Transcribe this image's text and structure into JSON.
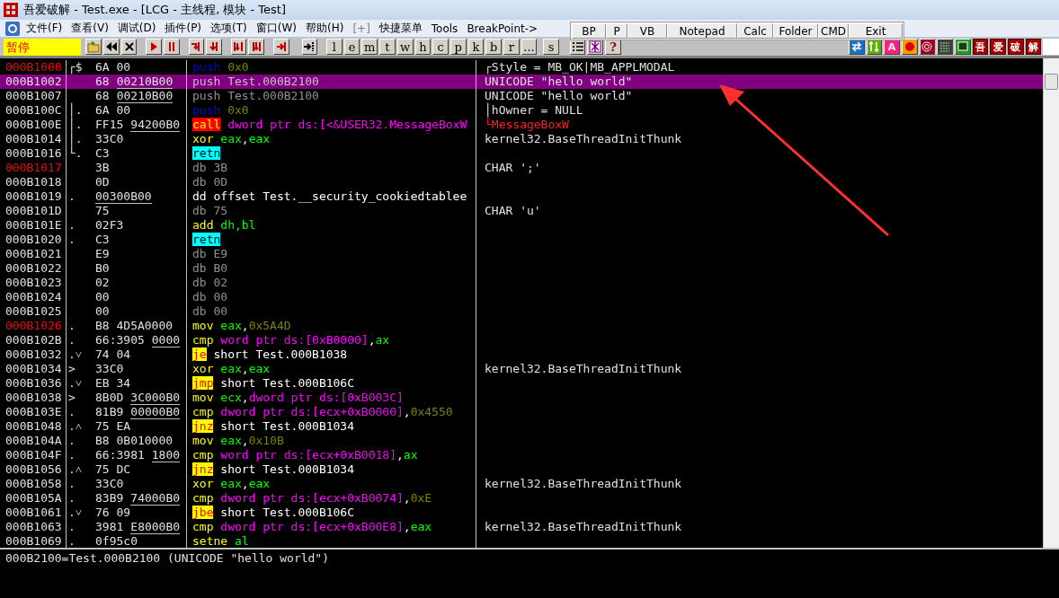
{
  "window": {
    "title": "吾爱破解 - Test.exe - [LCG - 主线程, 模块 - Test]"
  },
  "menu": [
    {
      "label": "文件(F)",
      "disabled": false
    },
    {
      "label": "查看(V)",
      "disabled": false
    },
    {
      "label": "调试(D)",
      "disabled": false
    },
    {
      "label": "插件(P)",
      "disabled": false
    },
    {
      "label": "选项(T)",
      "disabled": false
    },
    {
      "label": "窗口(W)",
      "disabled": false
    },
    {
      "label": "帮助(H)",
      "disabled": false
    },
    {
      "label": "[+]",
      "disabled": true
    },
    {
      "label": "快捷菜单",
      "disabled": false
    },
    {
      "label": "Tools",
      "disabled": false
    },
    {
      "label": "BreakPoint->",
      "disabled": false
    }
  ],
  "tool_popup": [
    "BP",
    "P",
    "VB",
    "Notepad",
    "Calc",
    "Folder",
    "CMD",
    "Exit"
  ],
  "toolbar": {
    "status": "暂停",
    "letters": [
      "l",
      "e",
      "m",
      "t",
      "w",
      "h",
      "c",
      "p",
      "k",
      "b",
      "r",
      "...",
      "s"
    ],
    "help": "?",
    "font_icon": "A",
    "brand_keys": [
      "吾",
      "爱",
      "破",
      "解"
    ]
  },
  "rows": [
    {
      "address": "000B1000",
      "marked": true,
      "selected": false,
      "marker": "┌$",
      "hex": "6A 00",
      "asm": [
        {
          "kind": "push",
          "t": "push"
        },
        {
          "kind": "imm",
          "t": " 0x0"
        }
      ],
      "comment": {
        "t": "┌Style = MB_OK|MB_APPLMODAL",
        "kind": "plain"
      }
    },
    {
      "address": "000B1002",
      "marked": false,
      "selected": true,
      "hex": "68",
      "ref": "00210B00",
      "asm": [
        {
          "kind": "dim",
          "t": "push Test.000B2100"
        }
      ],
      "comment": {
        "t": "UNICODE \"hello world\"",
        "kind": "plain"
      }
    },
    {
      "address": "000B1007",
      "marked": false,
      "selected": false,
      "hex": "68",
      "ref": "00210B00",
      "asm": [
        {
          "kind": "dim",
          "t": "push Test.000B2100"
        }
      ],
      "comment": {
        "t": "UNICODE \"hello world\"",
        "kind": "plain"
      }
    },
    {
      "address": "000B100C",
      "marked": false,
      "selected": false,
      "marker": "│.",
      "hex": "6A 00",
      "asm": [
        {
          "kind": "push",
          "t": "push"
        },
        {
          "kind": "imm",
          "t": " 0x0"
        }
      ],
      "comment": {
        "t": "│hOwner = NULL",
        "kind": "plain"
      }
    },
    {
      "address": "000B100E",
      "marked": false,
      "selected": false,
      "marker": "│.",
      "hex": "FF15",
      "ref": "94200B0",
      "asm": [
        {
          "kind": "call",
          "t": "call"
        },
        {
          "kind": "mem",
          "t": " dword ptr ds:[<&USER32.MessageBoxW"
        }
      ],
      "comment": {
        "t": "└MessageBoxW",
        "kind": "api"
      }
    },
    {
      "address": "000B1014",
      "marked": false,
      "selected": false,
      "marker": "│.",
      "hex": "33C0",
      "asm": [
        {
          "kind": "op",
          "t": "xor"
        },
        {
          "kind": "reg",
          "t": " eax"
        },
        {
          "kind": "text",
          "t": ","
        },
        {
          "kind": "reg",
          "t": "eax"
        }
      ],
      "comment": {
        "t": "kernel32.BaseThreadInitThunk",
        "kind": "plain"
      }
    },
    {
      "address": "000B1016",
      "marked": false,
      "selected": false,
      "marker": "└.",
      "hex": "C3",
      "asm": [
        {
          "kind": "ret",
          "t": "retn"
        }
      ]
    },
    {
      "address": "000B1017",
      "marked": true,
      "selected": false,
      "hex": "3B",
      "asm": [
        {
          "kind": "dim",
          "t": "db 3B"
        }
      ],
      "comment": {
        "t": "CHAR ';'",
        "kind": "plain"
      }
    },
    {
      "address": "000B1018",
      "marked": false,
      "selected": false,
      "hex": "0D",
      "asm": [
        {
          "kind": "dim",
          "t": "db 0D"
        }
      ]
    },
    {
      "address": "000B1019",
      "marked": false,
      "selected": false,
      "marker": ".",
      "ref": "00300B00",
      "asm": [
        {
          "kind": "text",
          "t": "dd offset Test.__security_cookiedtablee"
        }
      ]
    },
    {
      "address": "000B101D",
      "marked": false,
      "selected": false,
      "hex": "75",
      "asm": [
        {
          "kind": "dim",
          "t": "db 75"
        }
      ],
      "comment": {
        "t": "CHAR 'u'",
        "kind": "plain"
      }
    },
    {
      "address": "000B101E",
      "marked": false,
      "selected": false,
      "marker": ".",
      "hex": "02F3",
      "asm": [
        {
          "kind": "op",
          "t": "add"
        },
        {
          "kind": "reg",
          "t": " dh,bl"
        }
      ]
    },
    {
      "address": "000B1020",
      "marked": false,
      "selected": false,
      "marker": ".",
      "hex": "C3",
      "asm": [
        {
          "kind": "ret",
          "t": "retn"
        }
      ]
    },
    {
      "address": "000B1021",
      "marked": false,
      "selected": false,
      "hex": "E9",
      "asm": [
        {
          "kind": "dim",
          "t": "db E9"
        }
      ]
    },
    {
      "address": "000B1022",
      "marked": false,
      "selected": false,
      "hex": "B0",
      "asm": [
        {
          "kind": "dim",
          "t": "db B0"
        }
      ]
    },
    {
      "address": "000B1023",
      "marked": false,
      "selected": false,
      "hex": "02",
      "asm": [
        {
          "kind": "dim",
          "t": "db 02"
        }
      ]
    },
    {
      "address": "000B1024",
      "marked": false,
      "selected": false,
      "hex": "00",
      "asm": [
        {
          "kind": "dim",
          "t": "db 00"
        }
      ]
    },
    {
      "address": "000B1025",
      "marked": false,
      "selected": false,
      "hex": "00",
      "asm": [
        {
          "kind": "dim",
          "t": "db 00"
        }
      ]
    },
    {
      "address": "000B1026",
      "marked": true,
      "selected": false,
      "marker": ".",
      "hex": "B8 4D5A0000",
      "asm": [
        {
          "kind": "op",
          "t": "mov"
        },
        {
          "kind": "reg",
          "t": " eax"
        },
        {
          "kind": "text",
          "t": ","
        },
        {
          "kind": "imm",
          "t": "0x5A4D"
        }
      ]
    },
    {
      "address": "000B102B",
      "marked": false,
      "selected": false,
      "marker": ".",
      "hex": "66:3905",
      "ref": "0000",
      "asm": [
        {
          "kind": "op",
          "t": "cmp"
        },
        {
          "kind": "mem",
          "t": " word ptr ds:[0xB0000]"
        },
        {
          "kind": "text",
          "t": ","
        },
        {
          "kind": "reg",
          "t": "ax"
        }
      ]
    },
    {
      "address": "000B1032",
      "marked": false,
      "selected": false,
      "marker": ".˅",
      "hex": "74 04",
      "asm": [
        {
          "kind": "jump",
          "t": "je"
        },
        {
          "kind": "text",
          "t": " short Test.000B1038"
        }
      ]
    },
    {
      "address": "000B1034",
      "marked": false,
      "selected": false,
      "marker": ">",
      "hex": "33C0",
      "asm": [
        {
          "kind": "op",
          "t": "xor"
        },
        {
          "kind": "reg",
          "t": " eax"
        },
        {
          "kind": "text",
          "t": ","
        },
        {
          "kind": "reg",
          "t": "eax"
        }
      ],
      "comment": {
        "t": "kernel32.BaseThreadInitThunk",
        "kind": "plain"
      }
    },
    {
      "address": "000B1036",
      "marked": false,
      "selected": false,
      "marker": ".˅",
      "hex": "EB 34",
      "asm": [
        {
          "kind": "jump",
          "t": "jmp"
        },
        {
          "kind": "text",
          "t": " short Test.000B106C"
        }
      ]
    },
    {
      "address": "000B1038",
      "marked": false,
      "selected": false,
      "marker": ">",
      "hex": "8B0D",
      "ref": "3C000B0",
      "asm": [
        {
          "kind": "op",
          "t": "mov"
        },
        {
          "kind": "reg",
          "t": " ecx"
        },
        {
          "kind": "text",
          "t": ","
        },
        {
          "kind": "mem",
          "t": "dword ptr ds:[0xB003C]"
        }
      ]
    },
    {
      "address": "000B103E",
      "marked": false,
      "selected": false,
      "marker": ".",
      "hex": "81B9",
      "ref": "00000B0",
      "asm": [
        {
          "kind": "op",
          "t": "cmp"
        },
        {
          "kind": "mem",
          "t": " dword ptr ds:[ecx+0xB0000]"
        },
        {
          "kind": "text",
          "t": ","
        },
        {
          "kind": "imm",
          "t": "0x4550"
        }
      ]
    },
    {
      "address": "000B1048",
      "marked": false,
      "selected": false,
      "marker": ".˄",
      "hex": "75 EA",
      "asm": [
        {
          "kind": "jump",
          "t": "jnz"
        },
        {
          "kind": "text",
          "t": " short Test.000B1034"
        }
      ]
    },
    {
      "address": "000B104A",
      "marked": false,
      "selected": false,
      "marker": ".",
      "hex": "B8 0B010000",
      "asm": [
        {
          "kind": "op",
          "t": "mov"
        },
        {
          "kind": "reg",
          "t": " eax"
        },
        {
          "kind": "text",
          "t": ","
        },
        {
          "kind": "imm",
          "t": "0x10B"
        }
      ]
    },
    {
      "address": "000B104F",
      "marked": false,
      "selected": false,
      "marker": ".",
      "hex": "66:3981",
      "ref": "1800",
      "asm": [
        {
          "kind": "op",
          "t": "cmp"
        },
        {
          "kind": "mem",
          "t": " word ptr ds:[ecx+0xB0018]"
        },
        {
          "kind": "text",
          "t": ","
        },
        {
          "kind": "reg",
          "t": "ax"
        }
      ]
    },
    {
      "address": "000B1056",
      "marked": false,
      "selected": false,
      "marker": ".˄",
      "hex": "75 DC",
      "asm": [
        {
          "kind": "jump",
          "t": "jnz"
        },
        {
          "kind": "text",
          "t": " short Test.000B1034"
        }
      ]
    },
    {
      "address": "000B1058",
      "marked": false,
      "selected": false,
      "marker": ".",
      "hex": "33C0",
      "asm": [
        {
          "kind": "op",
          "t": "xor"
        },
        {
          "kind": "reg",
          "t": " eax"
        },
        {
          "kind": "text",
          "t": ","
        },
        {
          "kind": "reg",
          "t": "eax"
        }
      ],
      "comment": {
        "t": "kernel32.BaseThreadInitThunk",
        "kind": "plain"
      }
    },
    {
      "address": "000B105A",
      "marked": false,
      "selected": false,
      "marker": ".",
      "hex": "83B9",
      "ref": "74000B0",
      "asm": [
        {
          "kind": "op",
          "t": "cmp"
        },
        {
          "kind": "mem",
          "t": " dword ptr ds:[ecx+0xB0074]"
        },
        {
          "kind": "text",
          "t": ","
        },
        {
          "kind": "imm",
          "t": "0xE"
        }
      ]
    },
    {
      "address": "000B1061",
      "marked": false,
      "selected": false,
      "marker": ".˅",
      "hex": "76 09",
      "asm": [
        {
          "kind": "jump",
          "t": "jbe"
        },
        {
          "kind": "text",
          "t": " short Test.000B106C"
        }
      ]
    },
    {
      "address": "000B1063",
      "marked": false,
      "selected": false,
      "marker": ".",
      "hex": "3981",
      "ref": "E8000B0",
      "asm": [
        {
          "kind": "op",
          "t": "cmp"
        },
        {
          "kind": "mem",
          "t": " dword ptr ds:[ecx+0xB00E8]"
        },
        {
          "kind": "text",
          "t": ","
        },
        {
          "kind": "reg",
          "t": "eax"
        }
      ],
      "comment": {
        "t": "kernel32.BaseThreadInitThunk",
        "kind": "plain"
      }
    },
    {
      "address": "000B1069",
      "marked": false,
      "selected": false,
      "marker": ".",
      "hex": "0f95c0",
      "asm": [
        {
          "kind": "op",
          "t": "setne"
        },
        {
          "kind": "reg",
          "t": " al"
        }
      ]
    }
  ],
  "info": "000B2100=Test.000B2100 (UNICODE \"hello world\")"
}
